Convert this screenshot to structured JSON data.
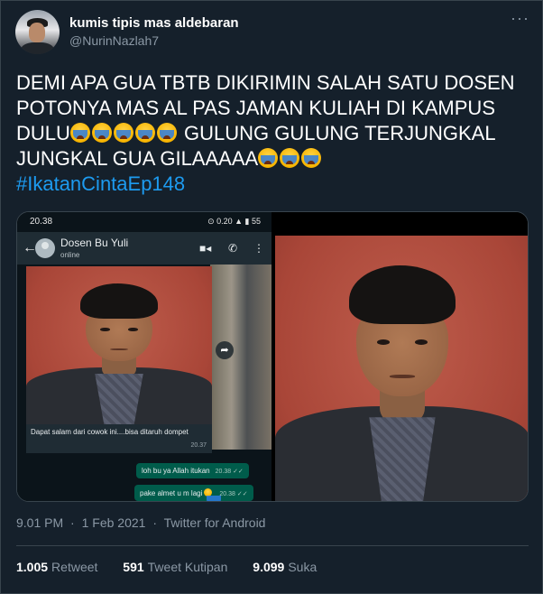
{
  "tweet": {
    "display_name": "kumis tipis mas aldebaran",
    "handle": "@NurinNazlah7",
    "lines": [
      "DEMI APA GUA TBTB DIKIRIMIN SALAH SATU DOSEN",
      "POTONYA MAS AL PAS JAMAN KULIAH DI KAMPUS",
      "DULU",
      "GULUNG GULUNG TERJUNGKAL",
      "JUNGKAL GUA GILAAAAA"
    ],
    "hashtag": "#IkatanCintaEp148",
    "more_icon": "more-horizontal-icon",
    "emoji_icon": "loudly-crying-face-icon"
  },
  "screenshot": {
    "status_time": "20.38",
    "status_icons": "⊙ 0.20 ▲ ▮ 55",
    "chat_name": "Dosen Bu Yuli",
    "chat_status": "online",
    "incoming_text": "Dapat salam dari cowok ini....bisa ditaruh dompet",
    "incoming_time": "20.37",
    "reply1_text": "loh bu ya Allah itukan",
    "reply1_time": "20.38 ✓✓",
    "reply2_text": "pake almet u m lagi",
    "reply2_time": "20.38 ✓✓"
  },
  "meta": {
    "time": "9.01 PM",
    "sep": "·",
    "date": "1 Feb 2021",
    "source": "Twitter for Android"
  },
  "stats": {
    "retweets_count": "1.005",
    "retweets_label": "Retweet",
    "quotes_count": "591",
    "quotes_label": "Tweet Kutipan",
    "likes_count": "9.099",
    "likes_label": "Suka"
  },
  "colors": {
    "background": "#15202b",
    "text": "#ffffff",
    "secondary": "#8b98a5",
    "link": "#1d9bf0",
    "border": "#38444d"
  }
}
